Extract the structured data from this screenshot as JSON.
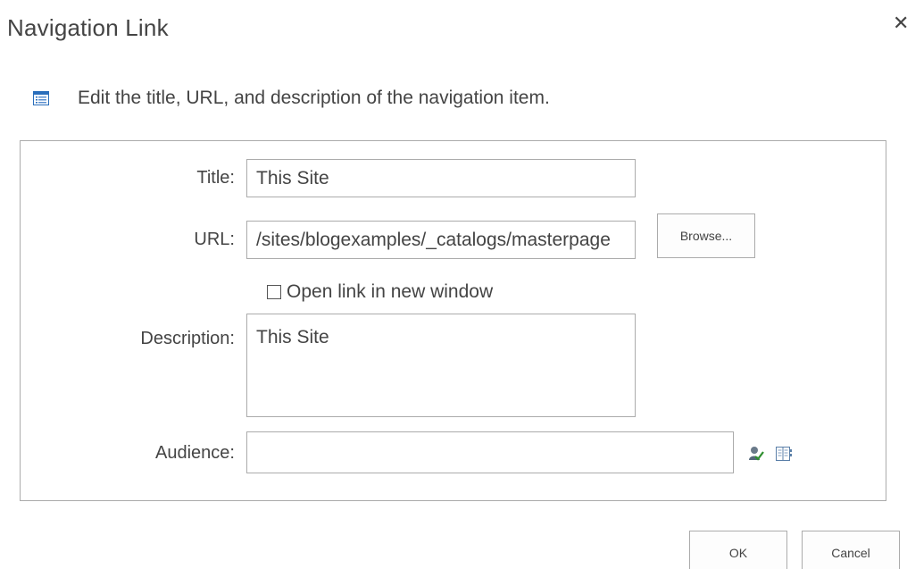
{
  "dialog": {
    "title": "Navigation Link",
    "close_glyph": "✕"
  },
  "instruction": {
    "icon": "list-page-icon",
    "text": "Edit the title, URL, and description of the navigation item."
  },
  "form": {
    "title": {
      "label": "Title:",
      "value": "This Site"
    },
    "url": {
      "label": "URL:",
      "value": "/sites/blogexamples/_catalogs/masterpage",
      "browse_label": "Browse..."
    },
    "open_new_window": {
      "label": "Open link in new window",
      "checked": false
    },
    "description": {
      "label": "Description:",
      "value": "This Site"
    },
    "audience": {
      "label": "Audience:",
      "value": "",
      "check_names_icon": "check-names-icon",
      "browse_icon": "address-book-icon"
    }
  },
  "footer": {
    "ok_label": "OK",
    "cancel_label": "Cancel"
  }
}
